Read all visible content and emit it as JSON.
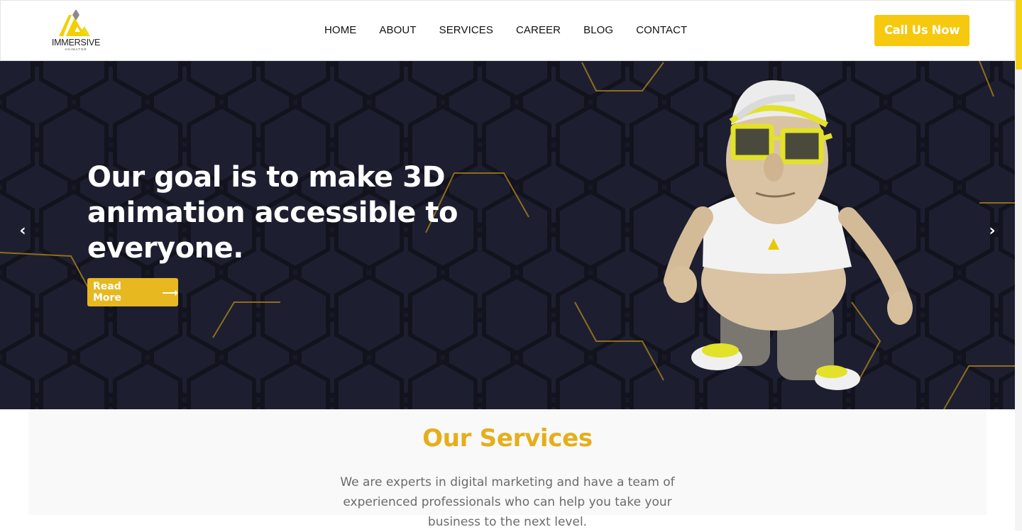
{
  "brand": {
    "name": "IMMERSIVE",
    "sub": "ANIMATOR",
    "accent": "#f6c90e"
  },
  "nav": {
    "items": [
      "HOME",
      "ABOUT",
      "SERVICES",
      "CAREER",
      "BLOG",
      "CONTACT"
    ],
    "cta_label": "Call Us Now"
  },
  "hero": {
    "title": "Our goal is to make 3D animation accessible to everyone.",
    "read_more_label": "Read More",
    "read_more_arrow": "⟶",
    "prev_arrow": "‹",
    "next_arrow": "›",
    "background": "#1b1d2e"
  },
  "services": {
    "title": "Our Services",
    "description": "We are experts in digital marketing and have a team of experienced professionals who can help you take your business to the next level.",
    "title_color": "#e5ae1b"
  }
}
